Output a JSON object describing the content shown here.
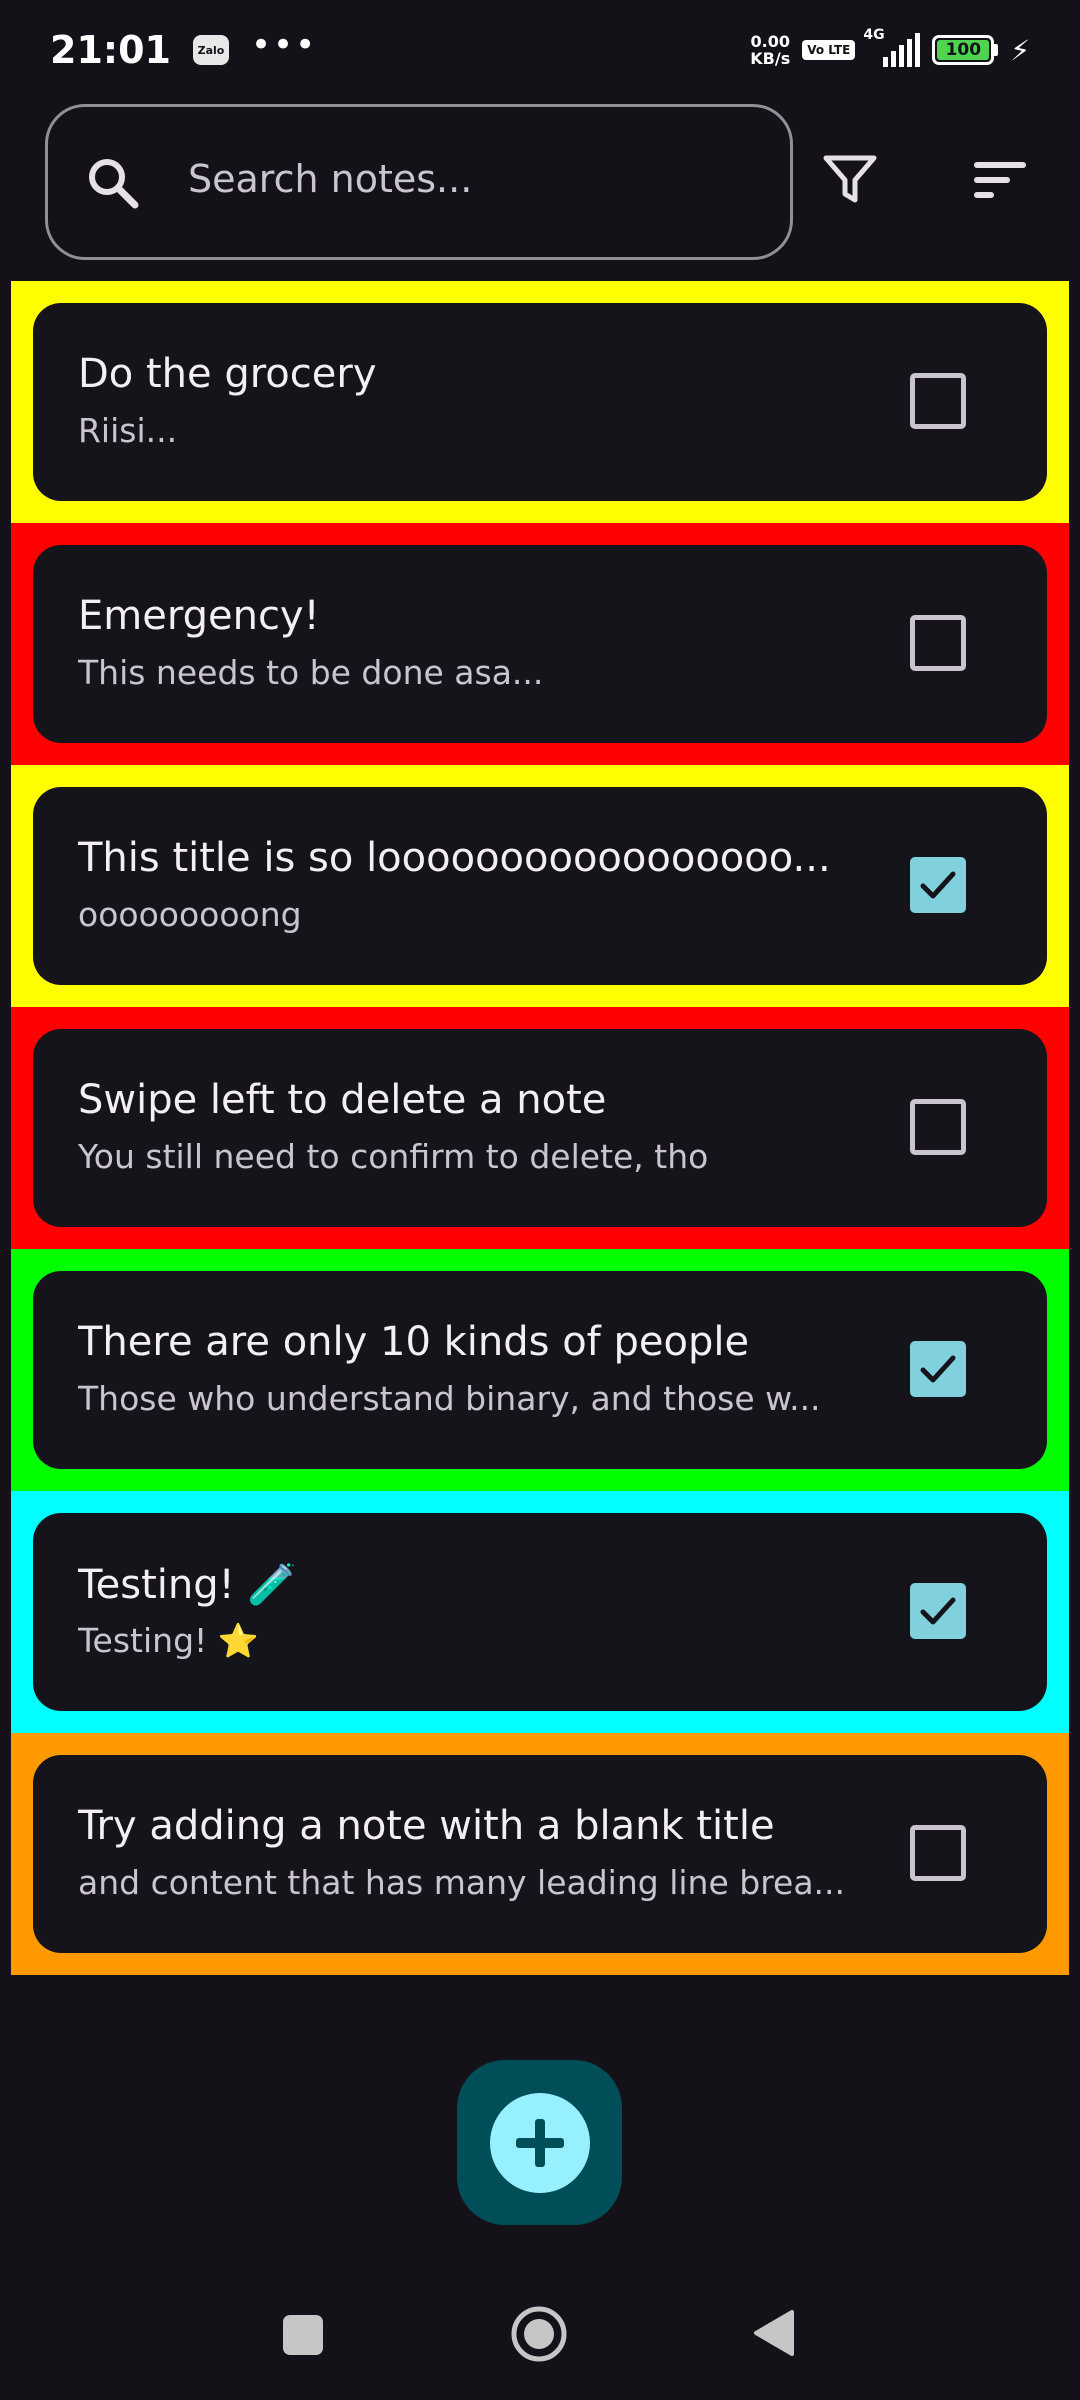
{
  "status_bar": {
    "time": "21:01",
    "app_icon": "Zalo",
    "more": "•••",
    "net_speed_value": "0.00",
    "net_speed_unit": "KB/s",
    "volte": "Vo LTE",
    "network": "4G",
    "battery": "100"
  },
  "search": {
    "placeholder": "Search notes..."
  },
  "icons": {
    "search": "search-icon",
    "filter": "filter-icon",
    "sort": "sort-icon",
    "add": "plus-icon",
    "check": "check-icon"
  },
  "notes": [
    {
      "title": "Do the grocery",
      "content": "Riisi...",
      "checked": false,
      "color": "#ffff00"
    },
    {
      "title": "Emergency!",
      "content": "This needs to be done asa...",
      "checked": false,
      "color": "#ff0000"
    },
    {
      "title": "This title is so looooooooooooooooo...",
      "content": "ooooooooong",
      "checked": true,
      "color": "#ffff00"
    },
    {
      "title": "Swipe left to delete a note",
      "content": "You still need to confirm to delete, tho",
      "checked": false,
      "color": "#ff0000"
    },
    {
      "title": "There are only 10 kinds of people",
      "content": "Those who understand binary, and those w...",
      "checked": true,
      "color": "#00ff00"
    },
    {
      "title": "Testing! 🧪",
      "content": "Testing! ⭐",
      "checked": true,
      "color": "#00ffff"
    },
    {
      "title": "Try adding a note with a blank title",
      "content": "and content that has many leading line brea...",
      "checked": false,
      "color": "#ff9900"
    }
  ],
  "colors": {
    "background": "#141218",
    "card": "#16141b",
    "accent": "#80d1dd",
    "fab_container": "#004f58",
    "fab_inner": "#97f0ff"
  }
}
